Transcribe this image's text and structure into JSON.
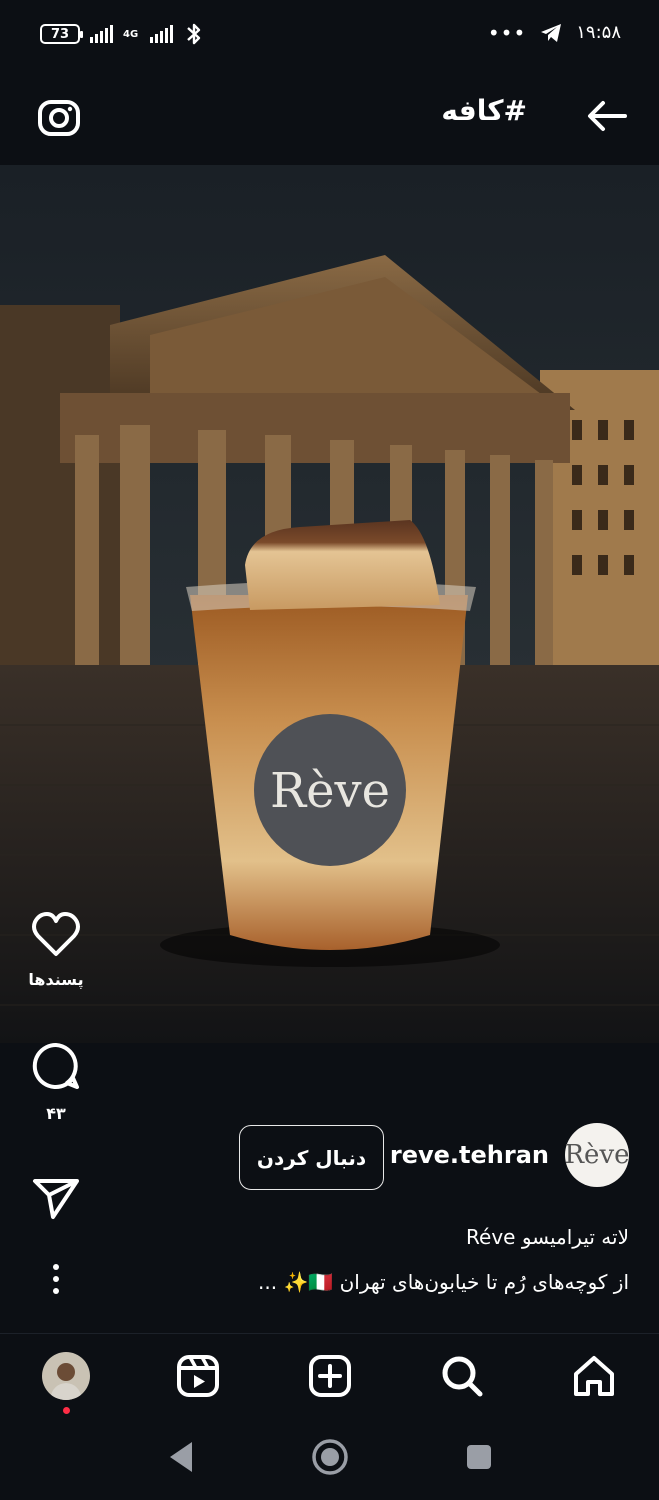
{
  "status_bar": {
    "battery": "73",
    "network": "4G",
    "time": "۱۹:۵۸",
    "dots": "•••"
  },
  "header": {
    "title": "#کافه"
  },
  "post": {
    "cup_logo": "Rève",
    "likes_label": "پسندها",
    "comments_count": "۴۳",
    "username": "reve.tehran",
    "avatar_text": "Rève",
    "follow_label": "دنبال کردن",
    "caption_line1": "لاته تیرامیسو Réve",
    "caption_line2": "از کوچه‌های رُم تا خیابون‌های تهران 🇮🇹✨ ..."
  },
  "icons": {
    "back": "arrow-left-icon",
    "camera": "camera-icon",
    "like": "heart-icon",
    "comment": "comment-icon",
    "share": "send-icon",
    "more": "more-vertical-icon",
    "home": "home-icon",
    "search": "search-icon",
    "create": "plus-square-icon",
    "reels": "reels-icon"
  },
  "colors": {
    "background": "#0c0f14",
    "notification_dot": "#ff2d46"
  }
}
